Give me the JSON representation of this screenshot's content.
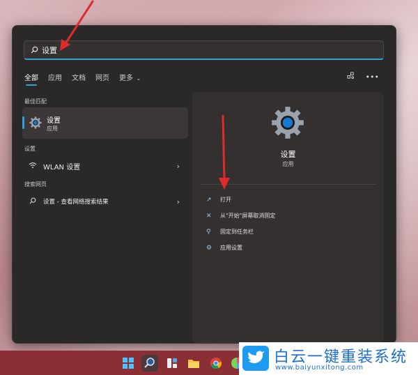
{
  "search": {
    "value": "设置"
  },
  "tabs": [
    {
      "label": "全部"
    },
    {
      "label": "应用"
    },
    {
      "label": "文档"
    },
    {
      "label": "网页"
    },
    {
      "label": "更多"
    }
  ],
  "sections": {
    "best_match": "最佳匹配",
    "settings": "设置",
    "web": "搜索网页"
  },
  "best_match": {
    "title": "设置",
    "subtitle": "应用"
  },
  "settings_result": {
    "label": "WLAN 设置"
  },
  "web_result": {
    "label": "设置 - 查看网络搜索结果"
  },
  "detail": {
    "title": "设置",
    "type": "应用",
    "actions": [
      {
        "label": "打开"
      },
      {
        "label": "从\"开始\"屏幕取消固定"
      },
      {
        "label": "固定到任务栏"
      },
      {
        "label": "应用设置"
      }
    ]
  },
  "watermark": {
    "name": "白云一键重装系统",
    "url": "www.baiyunxitong.com"
  },
  "colors": {
    "accent": "#2fa0d8",
    "panel": "#2b2828",
    "annotation": "#e12a2a",
    "taskbar": "#8c2f35"
  },
  "icons": [
    "search-icon",
    "chevron-down-icon",
    "share-icon",
    "more-icon",
    "gear-icon",
    "wifi-icon",
    "chevron-right-icon",
    "open-icon",
    "unpin-icon",
    "pin-icon",
    "app-settings-icon",
    "windows-icon",
    "twitter-bird-icon"
  ]
}
